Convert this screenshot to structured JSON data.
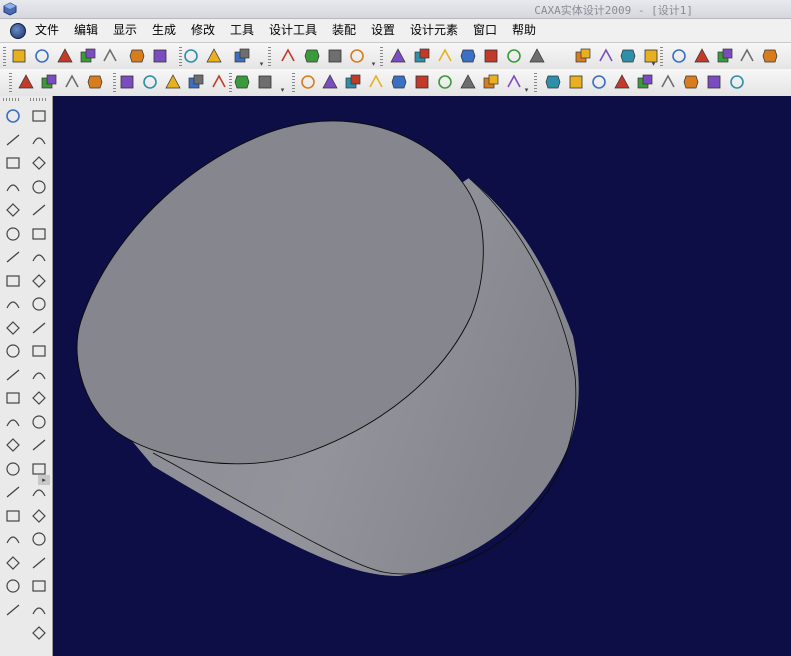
{
  "window": {
    "title": "CAXA实体设计2009 - [设计1]"
  },
  "menu": {
    "items": [
      {
        "id": "file",
        "label": "文件"
      },
      {
        "id": "edit",
        "label": "编辑"
      },
      {
        "id": "view",
        "label": "显示"
      },
      {
        "id": "generate",
        "label": "生成"
      },
      {
        "id": "modify",
        "label": "修改"
      },
      {
        "id": "tools",
        "label": "工具"
      },
      {
        "id": "design-tools",
        "label": "设计工具"
      },
      {
        "id": "assembly",
        "label": "装配"
      },
      {
        "id": "settings",
        "label": "设置"
      },
      {
        "id": "design-elements",
        "label": "设计元素"
      },
      {
        "id": "window",
        "label": "窗口"
      },
      {
        "id": "help",
        "label": "帮助"
      }
    ]
  },
  "toolbars": {
    "row1_icons": [
      "new-document-icon",
      "new-drawing-icon",
      "new-template-icon",
      "open-folder-icon",
      "save-icon",
      "undo-icon",
      "redo-icon",
      "render-sphere-icon",
      "text-effects-icon",
      "help-query-icon",
      "point-icon",
      "line-icon",
      "measure-icon",
      "axis-icon",
      "extrude-icon",
      "revolve-icon",
      "sweep-icon",
      "loft-icon",
      "hole-icon",
      "shell-icon",
      "boolean-icon",
      "coil-icon",
      "blend-icon",
      "move-face-icon",
      "delete-face-icon",
      "box-icon",
      "cylinder-icon",
      "cone-icon",
      "sphere-icon",
      "torus-icon",
      "pipe-icon"
    ],
    "row2_icons": [
      "part-icon",
      "assembly-icon",
      "group-icon",
      "component-icon",
      "insert-part-icon",
      "pattern-icon",
      "folder-icon",
      "library-icon",
      "catalog-icon",
      "tree-icon",
      "properties-icon",
      "sketch-image-icon",
      "sketch-plane-icon",
      "xyz-axis-icon",
      "section-icon",
      "projection-icon",
      "curve-icon",
      "equation-icon",
      "trim-icon",
      "fillet-curve-icon",
      "triad-icon",
      "push-pull-icon",
      "bend-icon",
      "stretch-icon",
      "flange-icon",
      "hem-icon",
      "corner-icon",
      "unfold-icon",
      "fold-icon",
      "stamp-icon"
    ]
  },
  "left_toolbar": {
    "icons": [
      "select-tool-icon",
      "spline-icon",
      "arc-tool-icon",
      "line-tool-icon",
      "polyline-icon",
      "rectangle-icon",
      "diamond-icon",
      "pentagon-icon",
      "circle-center-icon",
      "circle-icon",
      "circle-3pt-icon",
      "ellipse-icon",
      "arc-3pt-icon",
      "tangent-arc-icon",
      "fillet-arc-icon",
      "hook-arc-icon",
      "offset-icon",
      "revolve-curve-icon",
      "wave-curve-icon",
      "xyz-text-icon",
      "3d-box-icon",
      "bspline-icon",
      "rotate-icon",
      "square-icon",
      "stamp-icon",
      "mirror-icon",
      "array-icon",
      "grid-array-icon",
      "corner-rect-icon",
      "chamfer-icon",
      "extend-icon",
      "break-icon",
      "cut-scissors-icon",
      "pen-icon",
      "angle-dim-icon",
      "bowtie-icon",
      "arc-dim-icon",
      "line-dim-icon",
      "vertical-dim-icon",
      "corner-dim-icon",
      "edit-tool-icon",
      "constraint-icon",
      "target-icon",
      "list-icon",
      "slash-icon"
    ]
  },
  "colors": {
    "viewport_background": "#0d0e45",
    "cylinder_side": "#8e8f96",
    "cylinder_top": "#86878e",
    "cylinder_edge": "#0a0a0a",
    "toolbar_background": "#ececec"
  },
  "scene": {
    "object": "cylinder"
  }
}
